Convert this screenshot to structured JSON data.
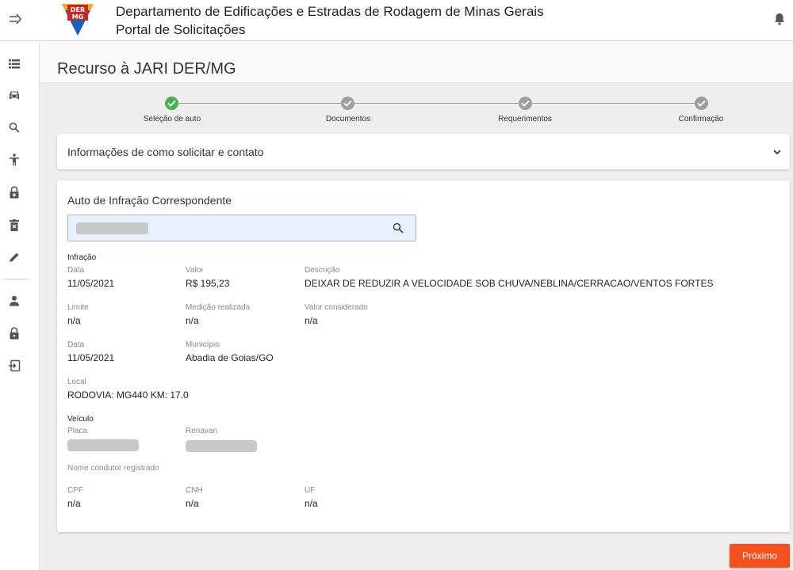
{
  "header": {
    "title_line1": "Departamento de Edificações e Estradas de Rodagem de Minas Gerais",
    "title_line2": "Portal de Solicitações",
    "logo_text_top": "DER",
    "logo_text_bottom": "MG",
    "menu_icon": "menu-toggle-arrow-icon",
    "notification_icon": "bell-icon"
  },
  "sidebar": {
    "icons": [
      "list-icon",
      "car-icon",
      "search-icon",
      "accessibility-icon",
      "lock-plus-icon",
      "delete-icon",
      "pencil-icon",
      "person-icon",
      "lock-icon",
      "login-icon"
    ]
  },
  "page": {
    "title": "Recurso à JARI DER/MG"
  },
  "stepper": {
    "steps": [
      {
        "label": "Seleção de auto",
        "status": "done"
      },
      {
        "label": "Documentos",
        "status": "pending"
      },
      {
        "label": "Requerimentos",
        "status": "pending"
      },
      {
        "label": "Confirmação",
        "status": "pending"
      }
    ]
  },
  "accordion": {
    "title": "Informações de como solicitar e contato"
  },
  "card": {
    "title": "Auto de Infração Correspondente",
    "infracao": {
      "heading": "Infração",
      "data_label": "Data",
      "data_value": "11/05/2021",
      "valor_label": "Valor",
      "valor_value": "R$ 195,23",
      "descricao_label": "Descrição",
      "descricao_value": "DEIXAR DE REDUZIR A VELOCIDADE SOB CHUVA/NEBLINA/CERRACAO/VENTOS FORTES",
      "limite_label": "Limite",
      "limite_value": "n/a",
      "medicao_label": "Medição realizada",
      "medicao_value": "n/a",
      "valor_considerado_label": "Valor considerado",
      "valor_considerado_value": "n/a",
      "data2_label": "Data",
      "data2_value": "11/05/2021",
      "municipio_label": "Município",
      "municipio_value": "Abadia de Goias/GO",
      "local_label": "Local",
      "local_value": "RODOVIA: MG440 KM: 17.0"
    },
    "veiculo": {
      "heading": "Veículo",
      "placa_label": "Placa",
      "renavan_label": "Renavan",
      "nome_condutor_label": "Nome condutor registrado",
      "cpf_label": "CPF",
      "cpf_value": "n/a",
      "cnh_label": "CNH",
      "cnh_value": "n/a",
      "uf_label": "UF",
      "uf_value": "n/a"
    }
  },
  "footer": {
    "next_label": "Próximo"
  },
  "colors": {
    "primary_button": "#f4511e",
    "step_done": "#4caf50",
    "step_pending": "#9e9e9e",
    "search_bg": "#e8f0fe"
  }
}
